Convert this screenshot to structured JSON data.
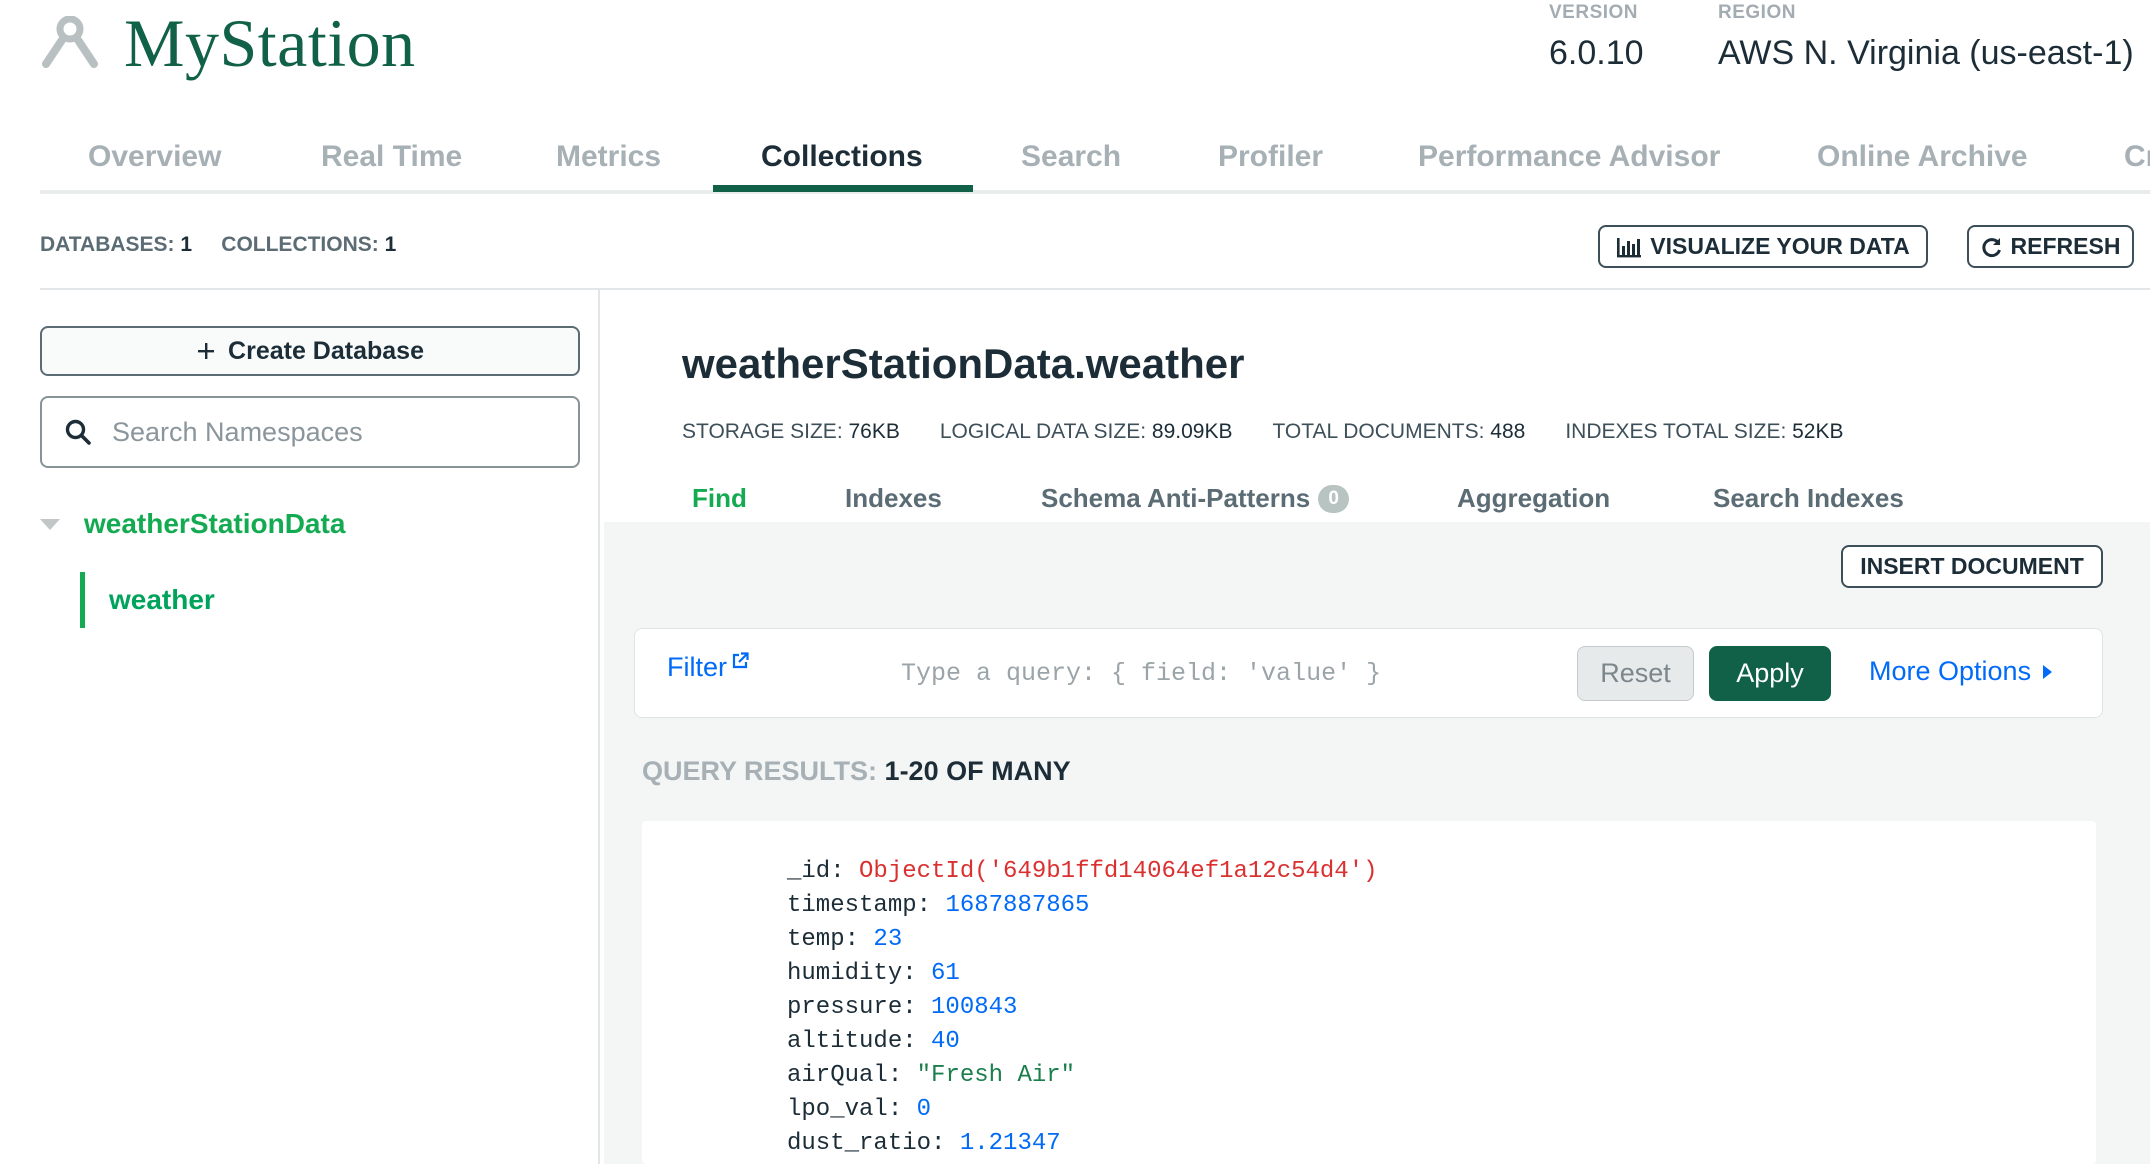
{
  "app": {
    "title": "MyStation"
  },
  "meta": {
    "version_label": "VERSION",
    "version": "6.0.10",
    "region_label": "REGION",
    "region": "AWS N. Virginia (us-east-1)"
  },
  "tabs": [
    "Overview",
    "Real Time",
    "Metrics",
    "Collections",
    "Search",
    "Profiler",
    "Performance Advisor",
    "Online Archive",
    "Cm"
  ],
  "active_tab": "Collections",
  "counts": {
    "databases_label": "DATABASES:",
    "databases": "1",
    "collections_label": "COLLECTIONS:",
    "collections": "1"
  },
  "actions": {
    "visualize": "VISUALIZE YOUR DATA",
    "refresh": "REFRESH",
    "insert": "INSERT DOCUMENT"
  },
  "sidebar": {
    "create_db": "Create Database",
    "search_placeholder": "Search Namespaces",
    "database": "weatherStationData",
    "collection": "weather"
  },
  "collection": {
    "title": "weatherStationData.weather",
    "stats": [
      {
        "label": "STORAGE SIZE:",
        "value": "76KB"
      },
      {
        "label": "LOGICAL DATA SIZE:",
        "value": "89.09KB"
      },
      {
        "label": "TOTAL DOCUMENTS:",
        "value": "488"
      },
      {
        "label": "INDEXES TOTAL SIZE:",
        "value": "52KB"
      }
    ]
  },
  "subtabs": [
    "Find",
    "Indexes",
    "Schema Anti-Patterns",
    "Aggregation",
    "Search Indexes"
  ],
  "anti_pattern_count": "0",
  "query": {
    "filter_label": "Filter",
    "placeholder": "Type a query: { field: 'value' }",
    "reset": "Reset",
    "apply": "Apply",
    "more_options": "More Options"
  },
  "results": {
    "label": "QUERY RESULTS:",
    "value": "1-20 OF MANY"
  },
  "document": [
    {
      "key": "_id",
      "value": "ObjectId('649b1ffd14064ef1a12c54d4')"
    },
    {
      "key": "timestamp",
      "value": "1687887865"
    },
    {
      "key": "temp",
      "value": "23"
    },
    {
      "key": "humidity",
      "value": "61"
    },
    {
      "key": "pressure",
      "value": "100843"
    },
    {
      "key": "altitude",
      "value": "40"
    },
    {
      "key": "airQual",
      "value": "\"Fresh Air\""
    },
    {
      "key": "lpo_val",
      "value": "0"
    },
    {
      "key": "dust_ratio",
      "value": "1.21347"
    }
  ],
  "colors": {
    "brand": "#116149",
    "accent": "#13aa52",
    "link": "#016bf8",
    "oid": "#db3030"
  }
}
